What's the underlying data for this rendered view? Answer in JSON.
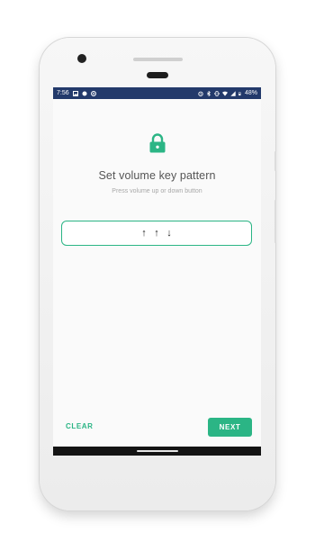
{
  "status_bar": {
    "time": "7:56",
    "battery": "48%",
    "left_icons": [
      "image-icon",
      "dot-icon",
      "circle-app-icon"
    ],
    "right_icons": [
      "alarm-icon",
      "bluetooth-icon",
      "vibrate-icon",
      "wifi-icon",
      "signal-icon",
      "battery-icon"
    ],
    "background": "#233a6b"
  },
  "screen": {
    "lock_icon": "lock-icon",
    "title": "Set volume key pattern",
    "subtitle": "Press volume up or down button",
    "pattern": [
      "↑",
      "↑",
      "↓"
    ],
    "clear_label": "CLEAR",
    "next_label": "NEXT"
  },
  "colors": {
    "accent": "#2bb585",
    "screen_bg": "#fafafa"
  }
}
